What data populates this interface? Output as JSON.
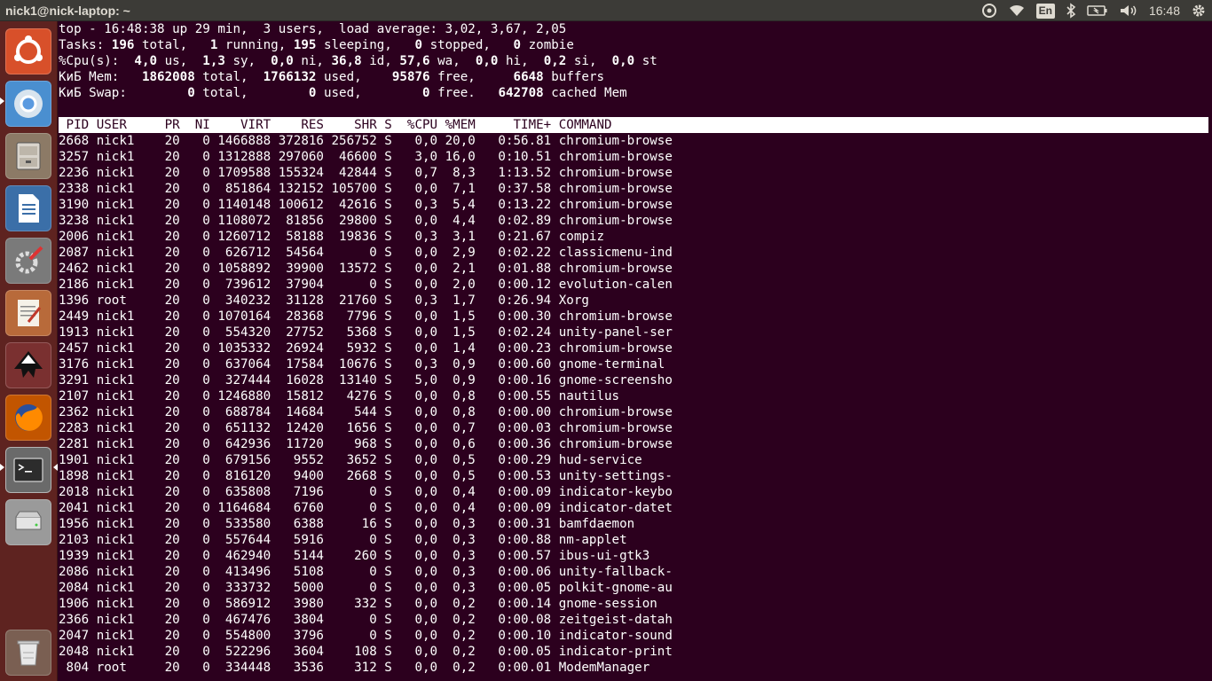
{
  "window": {
    "title": "nick1@nick-laptop: ~"
  },
  "panel": {
    "language": "En",
    "clock": "16:48"
  },
  "launcher": {
    "items": [
      {
        "name": "ubuntu-dash",
        "color": "#d64e28"
      },
      {
        "name": "chromium",
        "color": "#3f7fb8"
      },
      {
        "name": "files",
        "color": "#8a7d6b"
      },
      {
        "name": "libreoffice-writer",
        "color": "#3b6fa8"
      },
      {
        "name": "system-settings",
        "color": "#c0392b"
      },
      {
        "name": "text-editor",
        "color": "#c86a3a"
      },
      {
        "name": "inkscape",
        "color": "#8e3a3a"
      },
      {
        "name": "firefox",
        "color": "#e66000"
      },
      {
        "name": "terminal",
        "color": "#4a4a4a"
      },
      {
        "name": "disks",
        "color": "#9a9a9a"
      },
      {
        "name": "trash",
        "color": "#8a6a5a"
      }
    ]
  },
  "terminal": {
    "summary": {
      "l1": "top - 16:48:38 up 29 min,  3 users,  load average: 3,02, 3,67, 2,05",
      "l2": [
        {
          "t": "Tasks: "
        },
        {
          "t": "196",
          "b": true
        },
        {
          "t": " total,   "
        },
        {
          "t": "1",
          "b": true
        },
        {
          "t": " running, "
        },
        {
          "t": "195",
          "b": true
        },
        {
          "t": " sleeping,   "
        },
        {
          "t": "0",
          "b": true
        },
        {
          "t": " stopped,   "
        },
        {
          "t": "0",
          "b": true
        },
        {
          "t": " zombie"
        }
      ],
      "l3": [
        {
          "t": "%Cpu(s):  "
        },
        {
          "t": "4,0",
          "b": true
        },
        {
          "t": " us,  "
        },
        {
          "t": "1,3",
          "b": true
        },
        {
          "t": " sy,  "
        },
        {
          "t": "0,0",
          "b": true
        },
        {
          "t": " ni, "
        },
        {
          "t": "36,8",
          "b": true
        },
        {
          "t": " id, "
        },
        {
          "t": "57,6",
          "b": true
        },
        {
          "t": " wa,  "
        },
        {
          "t": "0,0",
          "b": true
        },
        {
          "t": " hi,  "
        },
        {
          "t": "0,2",
          "b": true
        },
        {
          "t": " si,  "
        },
        {
          "t": "0,0",
          "b": true
        },
        {
          "t": " st"
        }
      ],
      "l4": [
        {
          "t": "КиБ Mem:   "
        },
        {
          "t": "1862008",
          "b": true
        },
        {
          "t": " total,  "
        },
        {
          "t": "1766132",
          "b": true
        },
        {
          "t": " used,    "
        },
        {
          "t": "95876",
          "b": true
        },
        {
          "t": " free,     "
        },
        {
          "t": "6648",
          "b": true
        },
        {
          "t": " buffers"
        }
      ],
      "l5": [
        {
          "t": "КиБ Swap:        "
        },
        {
          "t": "0",
          "b": true
        },
        {
          "t": " total,        "
        },
        {
          "t": "0",
          "b": true
        },
        {
          "t": " used,        "
        },
        {
          "t": "0",
          "b": true
        },
        {
          "t": " free.   "
        },
        {
          "t": "642708",
          "b": true
        },
        {
          "t": " cached Mem"
        }
      ]
    },
    "header": [
      "PID",
      "USER",
      "PR",
      "NI",
      "VIRT",
      "RES",
      "SHR",
      "S",
      "%CPU",
      "%MEM",
      "TIME+",
      "COMMAND"
    ],
    "rows": [
      [
        "2668",
        "nick1",
        "20",
        "0",
        "1466888",
        "372816",
        "256752",
        "S",
        "0,0",
        "20,0",
        "0:56.81",
        "chromium-browse"
      ],
      [
        "3257",
        "nick1",
        "20",
        "0",
        "1312888",
        "297060",
        "46600",
        "S",
        "3,0",
        "16,0",
        "0:10.51",
        "chromium-browse"
      ],
      [
        "2236",
        "nick1",
        "20",
        "0",
        "1709588",
        "155324",
        "42844",
        "S",
        "0,7",
        "8,3",
        "1:13.52",
        "chromium-browse"
      ],
      [
        "2338",
        "nick1",
        "20",
        "0",
        "851864",
        "132152",
        "105700",
        "S",
        "0,0",
        "7,1",
        "0:37.58",
        "chromium-browse"
      ],
      [
        "3190",
        "nick1",
        "20",
        "0",
        "1140148",
        "100612",
        "42616",
        "S",
        "0,3",
        "5,4",
        "0:13.22",
        "chromium-browse"
      ],
      [
        "3238",
        "nick1",
        "20",
        "0",
        "1108072",
        "81856",
        "29800",
        "S",
        "0,0",
        "4,4",
        "0:02.89",
        "chromium-browse"
      ],
      [
        "2006",
        "nick1",
        "20",
        "0",
        "1260712",
        "58188",
        "19836",
        "S",
        "0,3",
        "3,1",
        "0:21.67",
        "compiz"
      ],
      [
        "2087",
        "nick1",
        "20",
        "0",
        "626712",
        "54564",
        "0",
        "S",
        "0,0",
        "2,9",
        "0:02.22",
        "classicmenu-ind"
      ],
      [
        "2462",
        "nick1",
        "20",
        "0",
        "1058892",
        "39900",
        "13572",
        "S",
        "0,0",
        "2,1",
        "0:01.88",
        "chromium-browse"
      ],
      [
        "2186",
        "nick1",
        "20",
        "0",
        "739612",
        "37904",
        "0",
        "S",
        "0,0",
        "2,0",
        "0:00.12",
        "evolution-calen"
      ],
      [
        "1396",
        "root",
        "20",
        "0",
        "340232",
        "31128",
        "21760",
        "S",
        "0,3",
        "1,7",
        "0:26.94",
        "Xorg"
      ],
      [
        "2449",
        "nick1",
        "20",
        "0",
        "1070164",
        "28368",
        "7796",
        "S",
        "0,0",
        "1,5",
        "0:00.30",
        "chromium-browse"
      ],
      [
        "1913",
        "nick1",
        "20",
        "0",
        "554320",
        "27752",
        "5368",
        "S",
        "0,0",
        "1,5",
        "0:02.24",
        "unity-panel-ser"
      ],
      [
        "2457",
        "nick1",
        "20",
        "0",
        "1035332",
        "26924",
        "5932",
        "S",
        "0,0",
        "1,4",
        "0:00.23",
        "chromium-browse"
      ],
      [
        "3176",
        "nick1",
        "20",
        "0",
        "637064",
        "17584",
        "10676",
        "S",
        "0,3",
        "0,9",
        "0:00.60",
        "gnome-terminal"
      ],
      [
        "3291",
        "nick1",
        "20",
        "0",
        "327444",
        "16028",
        "13140",
        "S",
        "5,0",
        "0,9",
        "0:00.16",
        "gnome-screensho"
      ],
      [
        "2107",
        "nick1",
        "20",
        "0",
        "1246880",
        "15812",
        "4276",
        "S",
        "0,0",
        "0,8",
        "0:00.55",
        "nautilus"
      ],
      [
        "2362",
        "nick1",
        "20",
        "0",
        "688784",
        "14684",
        "544",
        "S",
        "0,0",
        "0,8",
        "0:00.00",
        "chromium-browse"
      ],
      [
        "2283",
        "nick1",
        "20",
        "0",
        "651132",
        "12420",
        "1656",
        "S",
        "0,0",
        "0,7",
        "0:00.03",
        "chromium-browse"
      ],
      [
        "2281",
        "nick1",
        "20",
        "0",
        "642936",
        "11720",
        "968",
        "S",
        "0,0",
        "0,6",
        "0:00.36",
        "chromium-browse"
      ],
      [
        "1901",
        "nick1",
        "20",
        "0",
        "679156",
        "9552",
        "3652",
        "S",
        "0,0",
        "0,5",
        "0:00.29",
        "hud-service"
      ],
      [
        "1898",
        "nick1",
        "20",
        "0",
        "816120",
        "9400",
        "2668",
        "S",
        "0,0",
        "0,5",
        "0:00.53",
        "unity-settings-"
      ],
      [
        "2018",
        "nick1",
        "20",
        "0",
        "635808",
        "7196",
        "0",
        "S",
        "0,0",
        "0,4",
        "0:00.09",
        "indicator-keybo"
      ],
      [
        "2041",
        "nick1",
        "20",
        "0",
        "1164684",
        "6760",
        "0",
        "S",
        "0,0",
        "0,4",
        "0:00.09",
        "indicator-datet"
      ],
      [
        "1956",
        "nick1",
        "20",
        "0",
        "533580",
        "6388",
        "16",
        "S",
        "0,0",
        "0,3",
        "0:00.31",
        "bamfdaemon"
      ],
      [
        "2103",
        "nick1",
        "20",
        "0",
        "557644",
        "5916",
        "0",
        "S",
        "0,0",
        "0,3",
        "0:00.88",
        "nm-applet"
      ],
      [
        "1939",
        "nick1",
        "20",
        "0",
        "462940",
        "5144",
        "260",
        "S",
        "0,0",
        "0,3",
        "0:00.57",
        "ibus-ui-gtk3"
      ],
      [
        "2086",
        "nick1",
        "20",
        "0",
        "413496",
        "5108",
        "0",
        "S",
        "0,0",
        "0,3",
        "0:00.06",
        "unity-fallback-"
      ],
      [
        "2084",
        "nick1",
        "20",
        "0",
        "333732",
        "5000",
        "0",
        "S",
        "0,0",
        "0,3",
        "0:00.05",
        "polkit-gnome-au"
      ],
      [
        "1906",
        "nick1",
        "20",
        "0",
        "586912",
        "3980",
        "332",
        "S",
        "0,0",
        "0,2",
        "0:00.14",
        "gnome-session"
      ],
      [
        "2366",
        "nick1",
        "20",
        "0",
        "467476",
        "3804",
        "0",
        "S",
        "0,0",
        "0,2",
        "0:00.08",
        "zeitgeist-datah"
      ],
      [
        "2047",
        "nick1",
        "20",
        "0",
        "554800",
        "3796",
        "0",
        "S",
        "0,0",
        "0,2",
        "0:00.10",
        "indicator-sound"
      ],
      [
        "2048",
        "nick1",
        "20",
        "0",
        "522296",
        "3604",
        "108",
        "S",
        "0,0",
        "0,2",
        "0:00.05",
        "indicator-print"
      ],
      [
        "804",
        "root",
        "20",
        "0",
        "334448",
        "3536",
        "312",
        "S",
        "0,0",
        "0,2",
        "0:00.01",
        "ModemManager"
      ]
    ]
  }
}
